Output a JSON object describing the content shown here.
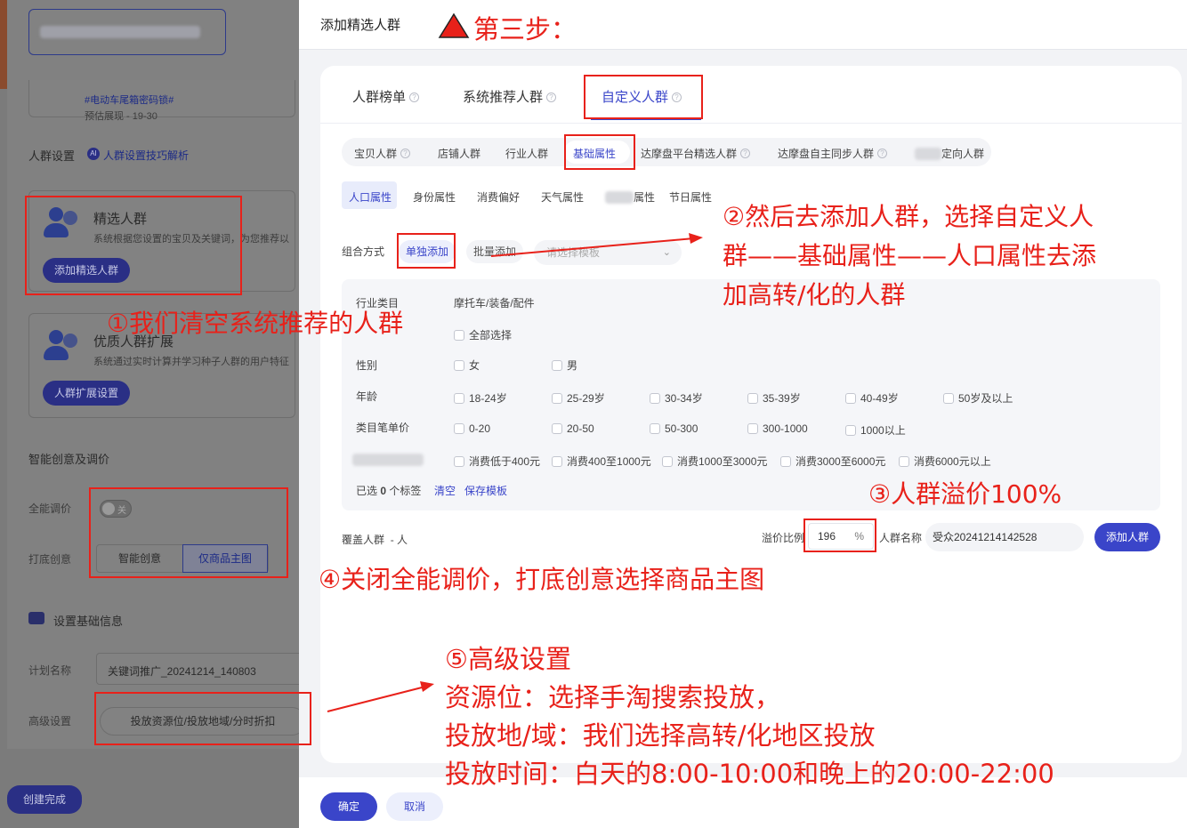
{
  "left_page": {
    "tag_text": "#电动车尾箱密码锁#",
    "estimate_text": "预估展现 - 19-30",
    "audience_section_title": "人群设置",
    "audience_tips_link": "人群设置技巧解析",
    "ai_badge": "AI",
    "selected_card": {
      "title": "精选人群",
      "desc": "系统根据您设置的宝贝及关键词，为您推荐以",
      "button": "添加精选人群"
    },
    "quality_card": {
      "title": "优质人群扩展",
      "desc": "系统通过实时计算并学习种子人群的用户特征",
      "button": "人群扩展设置"
    },
    "smart_section_title": "智能创意及调价",
    "full_adjust_label": "全能调价",
    "toggle_text": "关",
    "base_creative_label": "打底创意",
    "creative_options": [
      "智能创意",
      "仅商品主图"
    ],
    "basic_info_title": "设置基础信息",
    "plan_name_label": "计划名称",
    "plan_name_value": "关键词推广_20241214_140803",
    "advanced_label": "高级设置",
    "advanced_button": "投放资源位/投放地域/分时折扣",
    "finish_button": "创建完成"
  },
  "drawer": {
    "title": "添加精选人群",
    "tabs": [
      "人群榜单",
      "系统推荐人群",
      "自定义人群"
    ],
    "subtabs": [
      "宝贝人群",
      "店铺人群",
      "行业人群",
      "基础属性",
      "达摩盘平台精选人群",
      "达摩盘自主同步人群",
      "定向人群"
    ],
    "attr_tabs": [
      "人口属性",
      "身份属性",
      "消费偏好",
      "天气属性",
      "属性",
      "节日属性"
    ],
    "combine_label": "组合方式",
    "mode_single": "单独添加",
    "mode_batch": "批量添加",
    "template_placeholder": "请选择模板",
    "filters": {
      "industry_label": "行业类目",
      "industry_value": "摩托车/装备/配件",
      "select_all": "全部选择",
      "gender_label": "性别",
      "gender_options": [
        "女",
        "男"
      ],
      "age_label": "年龄",
      "age_options": [
        "18-24岁",
        "25-29岁",
        "30-34岁",
        "35-39岁",
        "40-49岁",
        "50岁及以上"
      ],
      "price_label": "类目笔单价",
      "price_options": [
        "0-20",
        "20-50",
        "50-300",
        "300-1000",
        "1000以上"
      ],
      "spend_options": [
        "消费低于400元",
        "消费400至1000元",
        "消费1000至3000元",
        "消费3000至6000元",
        "消费6000元以上"
      ],
      "selected_prefix": "已选",
      "selected_count": "0",
      "selected_suffix": "个标签",
      "clear_link": "清空",
      "save_template_link": "保存模板"
    },
    "coverage_label": "覆盖人群",
    "coverage_value": "- 人",
    "premium_label": "溢价比例",
    "premium_value": "196",
    "premium_unit": "%",
    "audience_name_label": "人群名称",
    "audience_name_value": "受众20241214142528",
    "add_button": "添加人群",
    "confirm_button": "确定",
    "cancel_button": "取消"
  },
  "annotations": {
    "step3": "第三步：",
    "note1": "①我们清空系统推荐的人群",
    "note2_lines": [
      "②然后去添加人群，选择自定义人",
      "群——基础属性——人口属性去添",
      "加高转/化的人群"
    ],
    "note3": "③人群溢价100%",
    "note4": "④关闭全能调价，打底创意选择商品主图",
    "note5_lines": [
      "⑤高级设置",
      "资源位：选择手淘搜索投放，",
      "投放地/域：我们选择高转/化地区投放",
      "投放时间：白天的8:00-10:00和晚上的20:00-22:00"
    ]
  },
  "colors": {
    "accent": "#3a45c9",
    "annotation_red": "#e8211a",
    "overlay_gray": "#7b7b7b"
  }
}
